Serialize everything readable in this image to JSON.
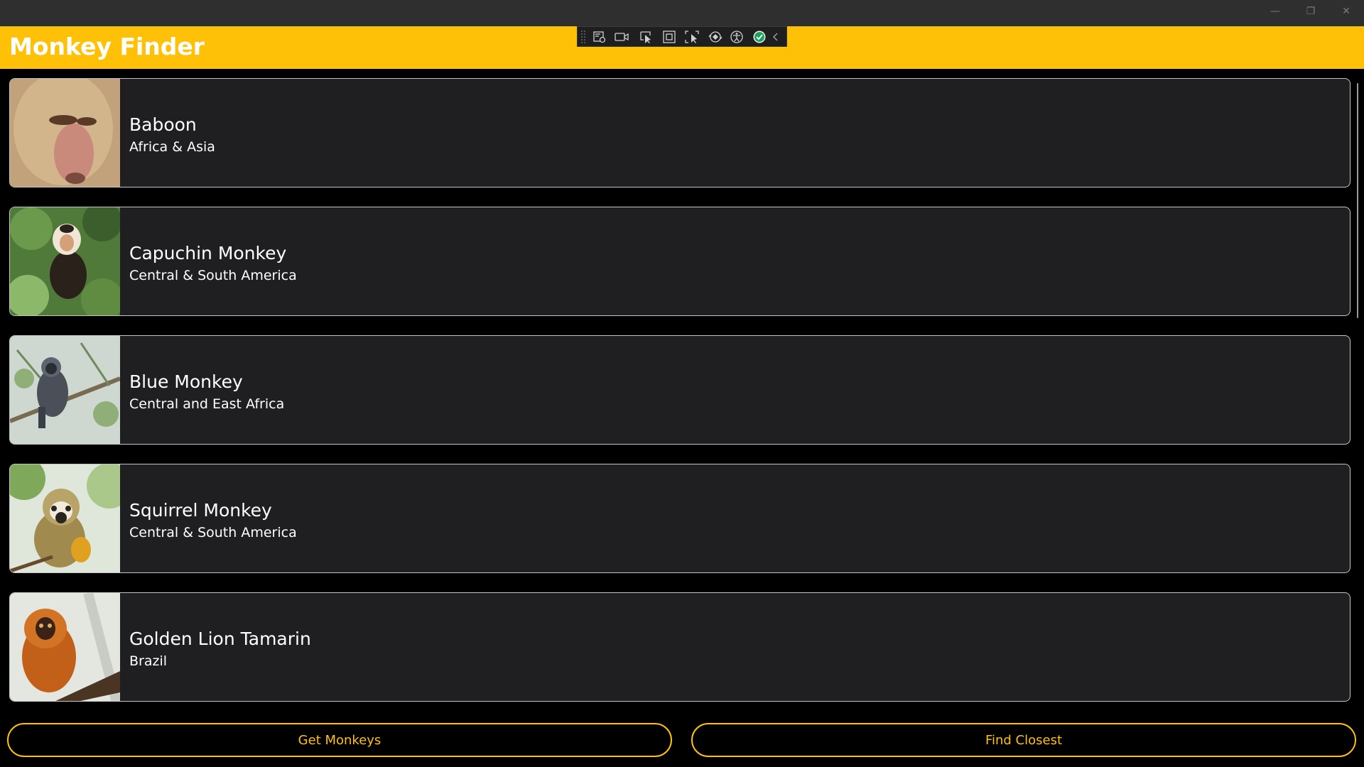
{
  "window": {
    "minimize_glyph": "—",
    "restore_glyph": "❐",
    "close_glyph": "✕"
  },
  "header": {
    "title": "Monkey Finder",
    "background": "#ffc107"
  },
  "debug_toolbar": {
    "icons": [
      "live-visual-tree-icon",
      "record-icon",
      "select-element-icon",
      "display-layout-adorners-icon",
      "track-focus-icon",
      "hot-reload-icon",
      "accessibility-checker-icon",
      "binding-success-icon",
      "collapse-toolbar-icon"
    ]
  },
  "monkeys": [
    {
      "name": "Baboon",
      "location": "Africa & Asia",
      "photo": "baboon-photo"
    },
    {
      "name": "Capuchin Monkey",
      "location": "Central & South America",
      "photo": "capuchin-photo"
    },
    {
      "name": "Blue Monkey",
      "location": "Central and East Africa",
      "photo": "blue-monkey-photo"
    },
    {
      "name": "Squirrel Monkey",
      "location": "Central & South America",
      "photo": "squirrel-monkey-photo"
    },
    {
      "name": "Golden Lion Tamarin",
      "location": "Brazil",
      "photo": "golden-lion-tamarin-photo"
    }
  ],
  "actions": {
    "get_monkeys": "Get Monkeys",
    "find_closest": "Find Closest"
  },
  "colors": {
    "accent": "#ffc107",
    "card_background": "#1f1f21",
    "card_border": "#c4c4c4",
    "page_background": "#000000"
  }
}
